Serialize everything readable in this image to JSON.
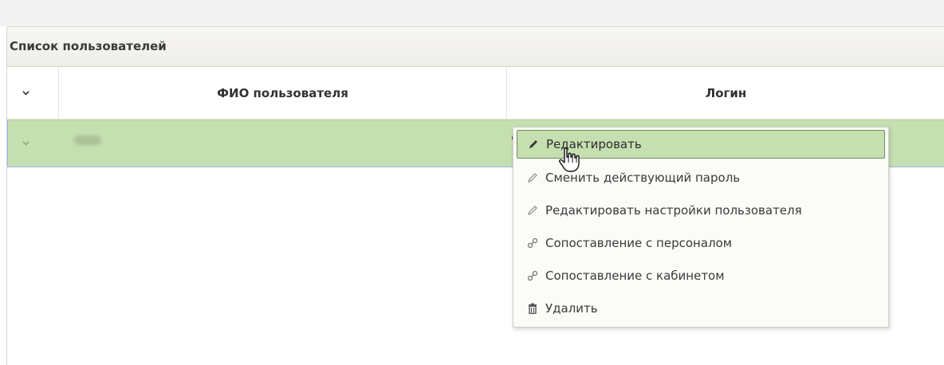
{
  "panel": {
    "title": "Список пользователей"
  },
  "table": {
    "columns": [
      "ФИО пользователя",
      "Логин"
    ]
  },
  "context_menu": {
    "items": [
      {
        "label": "Редактировать",
        "icon": "pencil-icon",
        "active": true
      },
      {
        "label": "Сменить действующий пароль",
        "icon": "pencil-icon"
      },
      {
        "label": "Редактировать настройки пользователя",
        "icon": "pencil-icon"
      },
      {
        "label": "Сопоставление с персоналом",
        "icon": "link-icon"
      },
      {
        "label": "Сопоставление с кабинетом",
        "icon": "link-icon"
      },
      {
        "label": "Удалить",
        "icon": "trash-icon"
      }
    ]
  },
  "colors": {
    "row_selected": "#c5dfb0",
    "row_border": "#97b9e2",
    "menu_active_border": "#6d8f5a"
  }
}
